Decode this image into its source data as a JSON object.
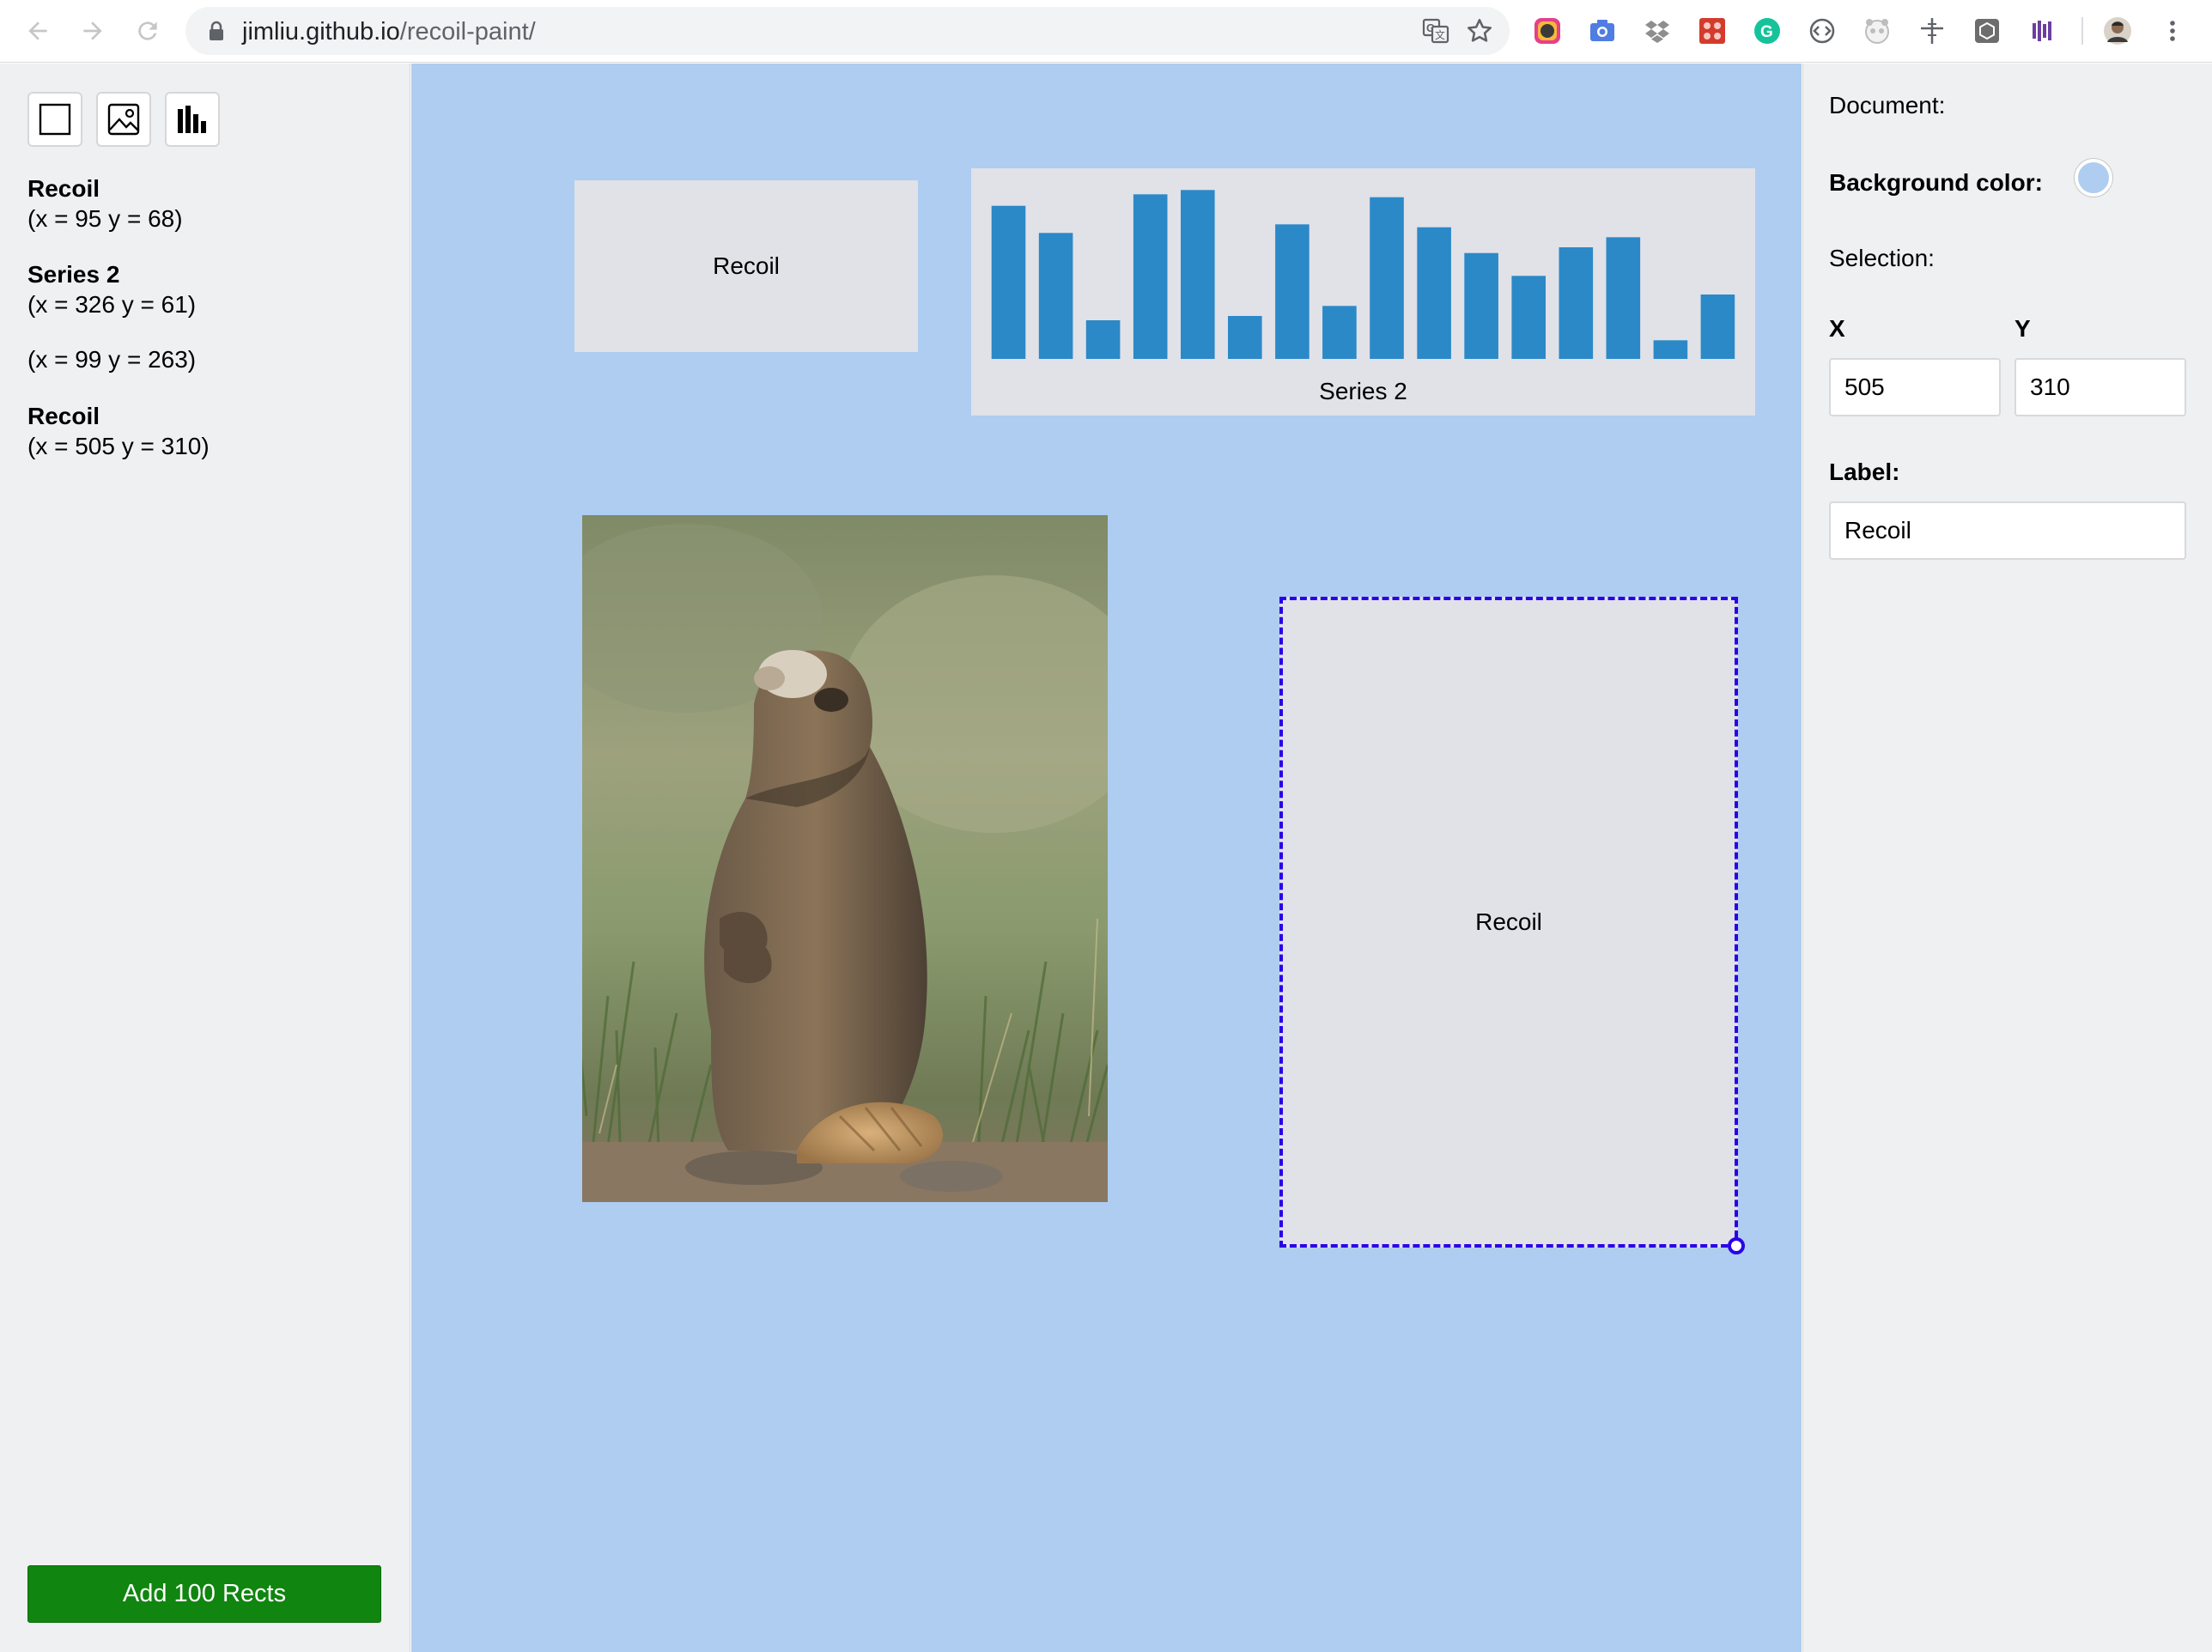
{
  "browser": {
    "url_host": "jimliu.github.io",
    "url_path": "/recoil-paint/",
    "nav_icons": [
      "back-icon",
      "forward-icon",
      "reload-icon"
    ],
    "extensions": [
      "color-picker-extension-icon",
      "camera-extension-icon",
      "dropbox-extension-icon",
      "puzzle-extension-icon",
      "grammarly-extension-icon",
      "code-extension-icon",
      "panda-extension-icon",
      "ruler-extension-icon",
      "cube-extension-icon",
      "bars-extension-icon",
      "profile-avatar",
      "more-menu-icon"
    ]
  },
  "toolbar": {
    "tools": [
      "rect-tool-icon",
      "image-tool-icon",
      "chart-tool-icon"
    ]
  },
  "layers": [
    {
      "name": "Recoil",
      "coords": "(x = 95 y = 68)"
    },
    {
      "name": "Series 2",
      "coords": "(x = 326 y = 61)"
    },
    {
      "name": "",
      "coords": "(x = 99 y = 263)"
    },
    {
      "name": "Recoil",
      "coords": "(x = 505 y = 310)"
    }
  ],
  "add_button_label": "Add 100 Rects",
  "canvas": {
    "background_color": "#aecdf1",
    "selection_color": "#2a00e8",
    "rect_1_label": "Recoil",
    "rect_3_label": "Recoil",
    "chart_label": "Series 2"
  },
  "chart_data": {
    "type": "bar",
    "values": [
      107,
      88,
      27,
      115,
      118,
      30,
      94,
      37,
      113,
      92,
      74,
      58,
      78,
      85,
      13,
      45
    ],
    "color": "#2b89c7",
    "title": "",
    "xlabel": "Series 2",
    "ylabel": ""
  },
  "inspector": {
    "document_label": "Document:",
    "background_label": "Background color:",
    "background_value": "#aecdf1",
    "selection_label": "Selection:",
    "x_label": "X",
    "y_label": "Y",
    "x_value": "505",
    "y_value": "310",
    "label_label": "Label:",
    "label_value": "Recoil"
  }
}
